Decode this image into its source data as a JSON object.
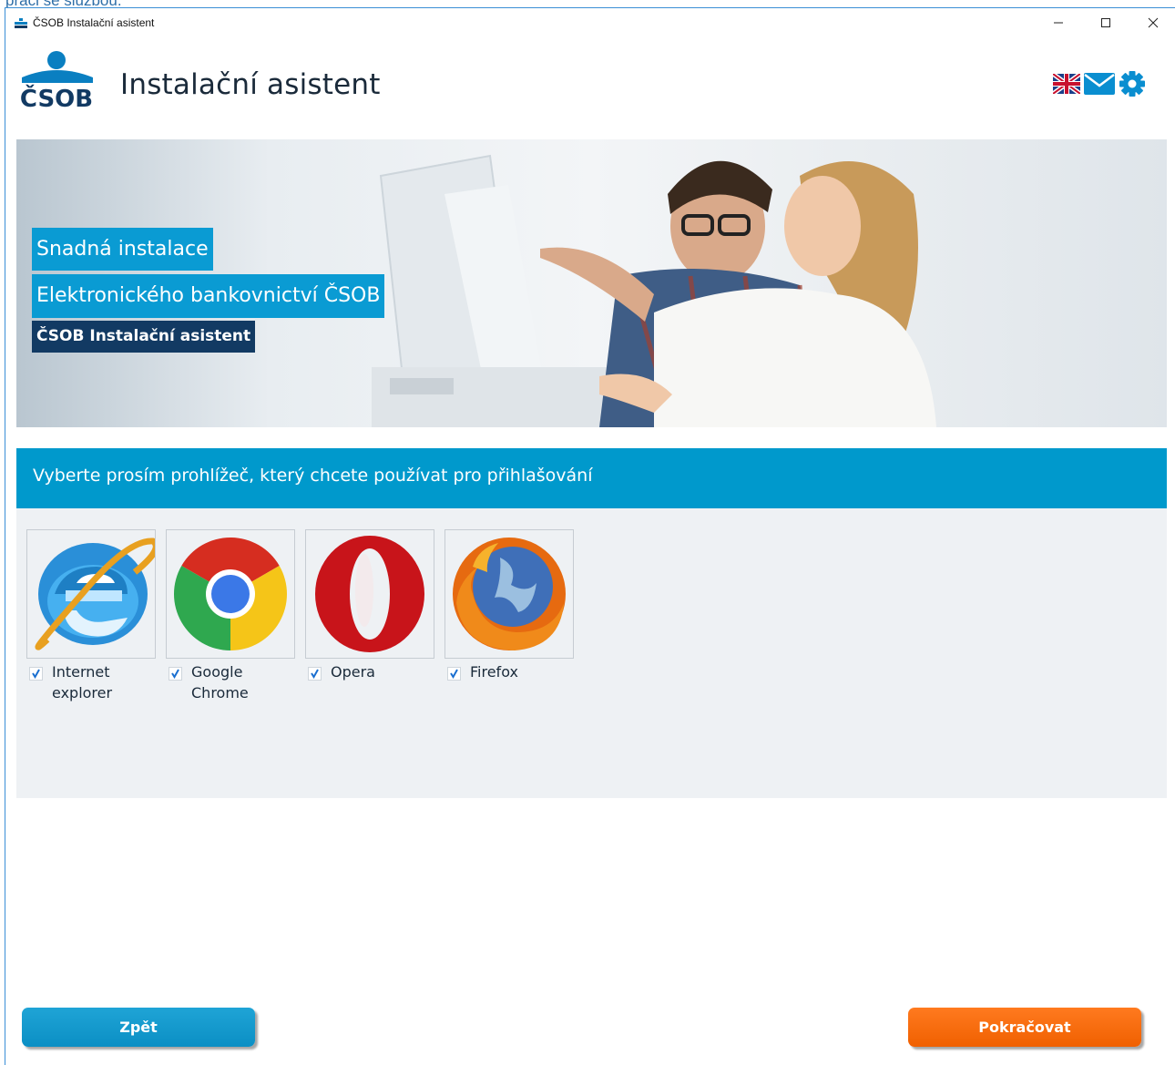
{
  "outer_text": "práci se službou.",
  "window": {
    "title": "ČSOB Instalační asistent",
    "controls": {
      "minimize": "minimize",
      "maximize": "maximize",
      "close": "close"
    }
  },
  "header": {
    "logo_text": "ČSOB",
    "app_title": "Instalační asistent",
    "icons": [
      "uk-flag-icon",
      "mail-icon",
      "gear-icon"
    ]
  },
  "banner": {
    "line1": "Snadná instalace",
    "line2": "Elektronického bankovnictví ČSOB",
    "line3": "ČSOB Instalační asistent"
  },
  "browser_section": {
    "heading": "Vyberte prosím prohlížeč, který chcete používat pro přihlašování",
    "browsers": [
      {
        "name": "Internet explorer",
        "icon": "internet-explorer-icon",
        "checked": true
      },
      {
        "name": "Google Chrome",
        "icon": "chrome-icon",
        "checked": true
      },
      {
        "name": "Opera",
        "icon": "opera-icon",
        "checked": true
      },
      {
        "name": "Firefox",
        "icon": "firefox-icon",
        "checked": true
      }
    ]
  },
  "footer": {
    "back_label": "Zpět",
    "next_label": "Pokračovat"
  },
  "colors": {
    "accent_blue": "#0099cc",
    "banner_dark": "#123a63",
    "next_orange": "#f26a0c",
    "panel_bg": "#eef1f4"
  }
}
